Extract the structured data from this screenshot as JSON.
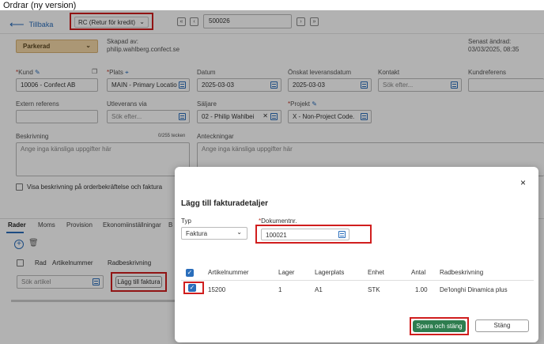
{
  "window_title": "Ordrar (ny version)",
  "topbar": {
    "back_label": "Tillbaka",
    "order_type": "RC (Retur för kredit)",
    "nav_first": "«",
    "nav_prev": "‹",
    "nav_next": "›",
    "nav_last": "»",
    "order_number": "500026"
  },
  "header": {
    "status": "Parkerad",
    "created_by_label": "Skapad av:",
    "created_by_value": "philip.wahlberg.confect.se",
    "last_changed_label": "Senast ändrad:",
    "last_changed_value": "03/03/2025, 08:35"
  },
  "form": {
    "customer_label": "Kund",
    "customer_value": "10006 - Confect AB",
    "site_label": "Plats",
    "site_value": "MAIN - Primary Locatio",
    "date_label": "Datum",
    "date_value": "2025-03-03",
    "delivery_date_label": "Önskat leveransdatum",
    "delivery_date_value": "2025-03-03",
    "contact_label": "Kontakt",
    "contact_placeholder": "Sök efter...",
    "customer_ref_label": "Kundreferens",
    "ext_ref_label": "Extern referens",
    "ship_via_label": "Utleverans via",
    "ship_via_placeholder": "Sök efter...",
    "seller_label": "Säljare",
    "seller_value": "02 - Philip Wahlbei",
    "project_label": "Projekt",
    "project_value": "X - Non-Project Code.",
    "description_label": "Beskrivning",
    "description_counter": "0/255 tecken",
    "description_placeholder": "Ange inga känsliga uppgifter här",
    "notes_label": "Anteckningar",
    "notes_placeholder": "Ange inga känsliga uppgifter här",
    "show_desc_label": "Visa beskrivning på orderbekräftelse och faktura"
  },
  "tabs": [
    "Rader",
    "Moms",
    "Provision",
    "Ekonomiinställningar",
    "B"
  ],
  "lines": {
    "col_rad": "Rad",
    "col_article": "Artikelnummer",
    "col_desc": "Radbeskrivning",
    "search_placeholder": "Sök artikel",
    "add_invoice_button": "Lägg till faktura"
  },
  "modal": {
    "title": "Lägg till fakturadetaljer",
    "close": "×",
    "type_label": "Typ",
    "type_value": "Faktura",
    "docno_label": "Dokumentnr.",
    "docno_value": "100021",
    "columns": [
      "Artikelnummer",
      "Lager",
      "Lagerplats",
      "Enhet",
      "Antal",
      "Radbeskrivning"
    ],
    "rows": [
      {
        "article": "15200",
        "warehouse": "1",
        "location": "A1",
        "unit": "STK",
        "qty": "1.00",
        "desc": "De'longhi Dinamica plus"
      }
    ],
    "save_button": "Spara och stäng",
    "close_button": "Stäng"
  },
  "colors": {
    "accent": "#2a6ebb",
    "highlight": "#d01e1e",
    "primary_button": "#2e7d4f",
    "status_bg": "#f5d9a8"
  }
}
